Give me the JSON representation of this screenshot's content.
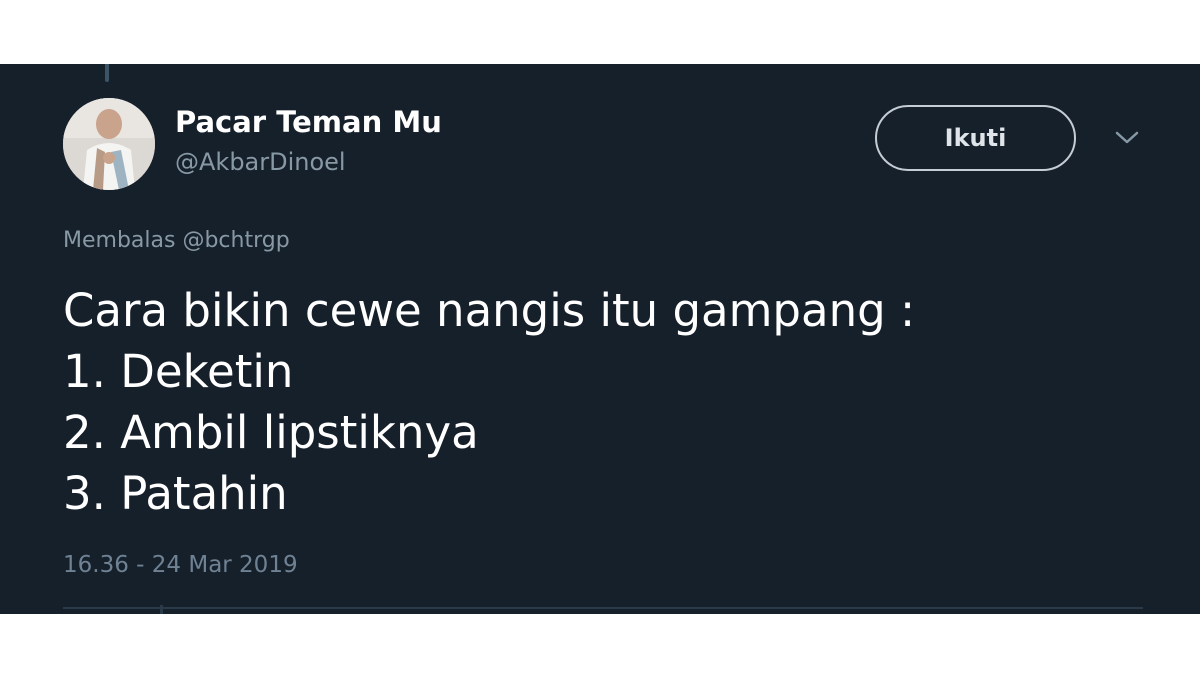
{
  "tweet": {
    "author": {
      "display_name": "Pacar Teman Mu",
      "handle": "@AkbarDinoel",
      "avatar_icon": "user-photo-avatar"
    },
    "follow_label": "Ikuti",
    "more_icon": "chevron-down-icon",
    "reply_context": {
      "prefix": "Membalas",
      "mention": "@bchtrgp"
    },
    "text_lines": [
      "Cara bikin cewe nangis itu gampang :",
      "1. Deketin",
      "2. Ambil lipstiknya",
      "3. Patahin"
    ],
    "timestamp": "16.36 - 24 Mar 2019"
  },
  "colors": {
    "card_background": "#16202b",
    "secondary_text": "#8899a6",
    "primary_text": "#ffffff",
    "button_border": "#c5ccd3"
  }
}
